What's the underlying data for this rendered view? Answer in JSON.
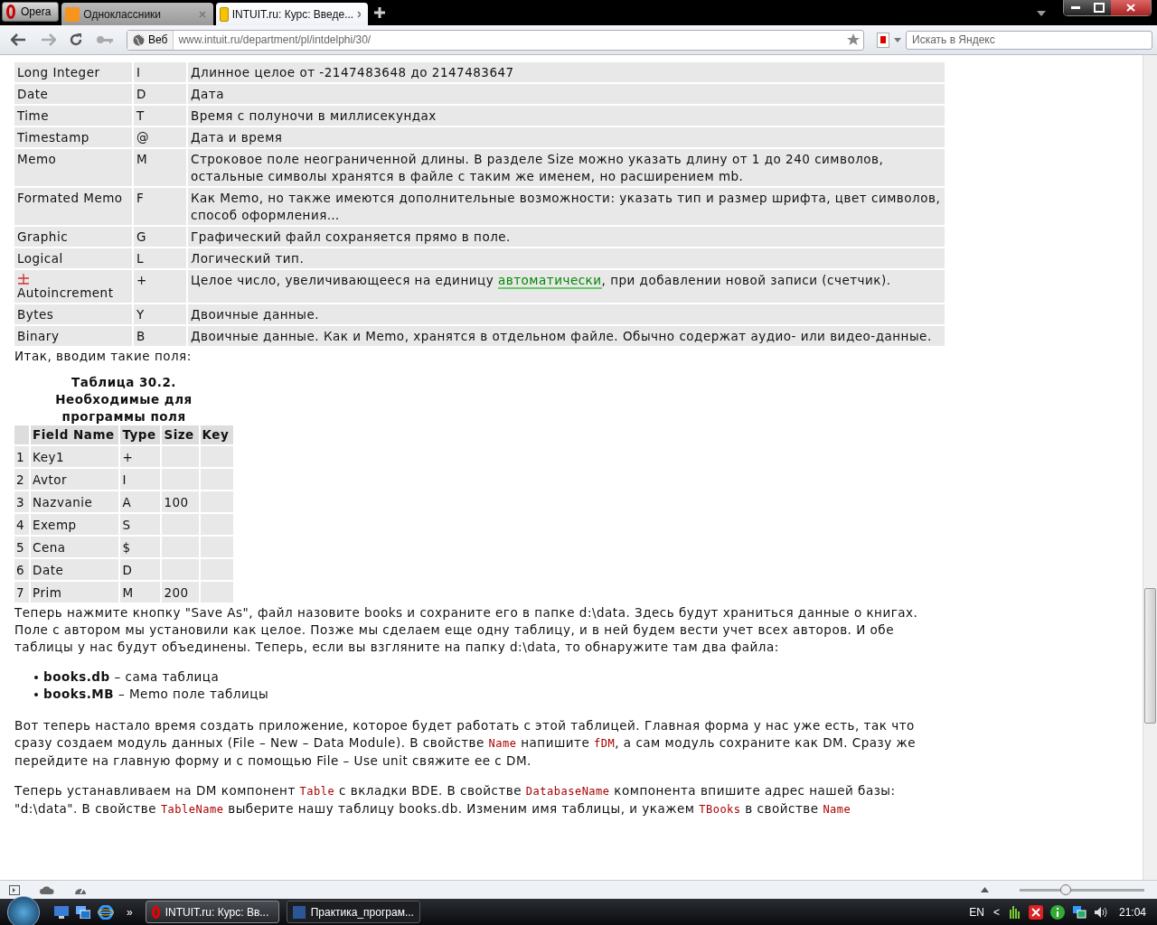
{
  "browser": {
    "menu_button": "Opera",
    "tabs": [
      {
        "title": "Одноклассники",
        "selected": false
      },
      {
        "title": "INTUIT.ru: Курс: Введе...",
        "selected": true
      }
    ],
    "address": {
      "badge": "Веб",
      "url": "www.intuit.ru/department/pl/intdelphi/30/"
    },
    "search": {
      "placeholder": "Искать в Яндекс"
    }
  },
  "types_table": {
    "rows": [
      {
        "name": "Long Integer",
        "code": "I",
        "description": [
          {
            "kind": "text",
            "text": "Длинное целое от -2147483648 до 2147483647"
          }
        ]
      },
      {
        "name": "Date",
        "code": "D",
        "description": [
          {
            "kind": "text",
            "text": "Дата"
          }
        ]
      },
      {
        "name": "Time",
        "code": "T",
        "description": [
          {
            "kind": "text",
            "text": "Время с полуночи в миллисекундах"
          }
        ]
      },
      {
        "name": "Timestamp",
        "code": "@",
        "description": [
          {
            "kind": "text",
            "text": "Дата и время"
          }
        ]
      },
      {
        "name": "Memo",
        "code": "M",
        "description": [
          {
            "kind": "text",
            "text": "Строковое поле неограниченной длины. В разделе Size можно указать длину от 1 до 240 символов, остальные символы хранятся в файле с таким же именем, но расширением mb."
          }
        ]
      },
      {
        "name": "Formated Memo",
        "code": "F",
        "description": [
          {
            "kind": "text",
            "text": "Как Memo, но также имеются дополнительные возможности: указать тип и размер шрифта, цвет символов, способ оформления…"
          }
        ]
      },
      {
        "name": "Graphic",
        "code": "G",
        "description": [
          {
            "kind": "text",
            "text": "Графический файл сохраняется прямо в поле."
          }
        ]
      },
      {
        "name": "Logical",
        "code": "L",
        "description": [
          {
            "kind": "text",
            "text": "Логический тип."
          }
        ]
      },
      {
        "name": "Autoincrement",
        "code": "+",
        "image_icon": true,
        "description": [
          {
            "kind": "text",
            "text": "Целое число, увеличивающееся на единицу "
          },
          {
            "kind": "link",
            "text": "автоматически"
          },
          {
            "kind": "text",
            "text": ", при добавлении новой записи (счетчик)."
          }
        ]
      },
      {
        "name": "Bytes",
        "code": "Y",
        "description": [
          {
            "kind": "text",
            "text": "Двоичные данные."
          }
        ]
      },
      {
        "name": "Binary",
        "code": "B",
        "description": [
          {
            "kind": "text",
            "text": "Двоичные данные. Как и Memo, хранятся в отдельном файле. Обычно содержат аудио- или видео-данные."
          }
        ]
      }
    ]
  },
  "intro": "Итак, вводим такие поля:",
  "fields_table": {
    "caption": "Таблица 30.2. Необходимые для программы поля",
    "columns": [
      "",
      "Field Name",
      "Type",
      "Size",
      "Key"
    ],
    "rows": [
      [
        "1",
        "Key1",
        "+",
        "",
        ""
      ],
      [
        "2",
        "Avtor",
        "I",
        "",
        ""
      ],
      [
        "3",
        "Nazvanie",
        "A",
        "100",
        ""
      ],
      [
        "4",
        "Exemp",
        "S",
        "",
        ""
      ],
      [
        "5",
        "Cena",
        "$",
        "",
        ""
      ],
      [
        "6",
        "Date",
        "D",
        "",
        ""
      ],
      [
        "7",
        "Prim",
        "M",
        "200",
        ""
      ]
    ]
  },
  "paragraph_1": "Теперь нажмите кнопку \"Save As\", файл назовите books и сохраните его в папке d:\\data. Здесь будут храниться данные о книгах. Поле с автором мы установили как целое. Позже мы сделаем еще одну таблицу, и в ней будем вести учет всех авторов. И обе таблицы у нас будут объединены. Теперь, если вы взгляните на папку d:\\data, то обнаружите там два файла:",
  "bullets": [
    "**books.db** – сама таблица",
    "**books.MB** – Memo поле таблицы"
  ],
  "paragraph_2": [
    {
      "kind": "text",
      "text": "Вот теперь настало время создать приложение, которое будет работать с этой таблицей. Главная форма у нас уже есть, так что сразу создаем модуль данных (File – New – Data Module). В свойстве "
    },
    {
      "kind": "code",
      "text": "Name"
    },
    {
      "kind": "text",
      "text": " напишите "
    },
    {
      "kind": "code",
      "text": "fDM"
    },
    {
      "kind": "text",
      "text": ", а сам модуль сохраните как DM. Сразу же перейдите на главную форму и с помощью File – Use unit свяжите ее с DM."
    }
  ],
  "paragraph_3": [
    {
      "kind": "text",
      "text": "Теперь устанавливаем на DM компонент "
    },
    {
      "kind": "code",
      "text": "Table"
    },
    {
      "kind": "text",
      "text": " с вкладки BDE. В свойстве "
    },
    {
      "kind": "code",
      "text": "DatabaseName"
    },
    {
      "kind": "text",
      "text": " компонента впишите адрес нашей базы: \"d:\\data\". В свойстве "
    },
    {
      "kind": "code",
      "text": "TableName"
    },
    {
      "kind": "text",
      "text": " выберите нашу таблицу books.db. Изменим имя таблицы, и укажем "
    },
    {
      "kind": "code",
      "text": "TBooks"
    },
    {
      "kind": "text",
      "text": " в свойстве "
    },
    {
      "kind": "code",
      "text": "Name"
    }
  ],
  "status_bar": {
    "zoom": {
      "level": 0.37
    }
  },
  "taskbar": {
    "more": "»",
    "tasks": [
      {
        "title": "INTUIT.ru: Курс: Вв...",
        "kind": "browser",
        "selected": true
      },
      {
        "title": "Практика_програм...",
        "kind": "document",
        "selected": false
      }
    ],
    "language": "EN",
    "tray_expand": "<",
    "clock": "21:04"
  }
}
